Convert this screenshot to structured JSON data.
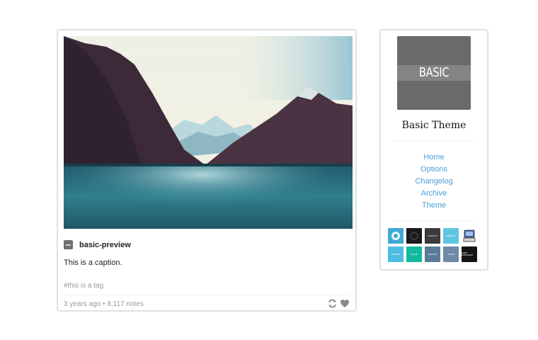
{
  "post": {
    "photo_alt": "",
    "author": "basic-preview",
    "caption": "This is a caption.",
    "tag": "#this is a tag",
    "date": "3 years ago",
    "notes": "8,117 notes",
    "separator": "•"
  },
  "sidebar": {
    "logo_text": "BASIC",
    "blog_title": "Basic Theme",
    "nav": [
      {
        "label": "Home"
      },
      {
        "label": "Options"
      },
      {
        "label": "Changelog"
      },
      {
        "label": "Archive"
      },
      {
        "label": "Theme"
      }
    ],
    "themes": [
      {
        "color": "#3fa9d4",
        "label": ""
      },
      {
        "color": "#1a1a1a",
        "label": ""
      },
      {
        "color": "#3b3b3b",
        "label": "COPYCAT"
      },
      {
        "color": "#5fc6e0",
        "label": "SIMPLEX"
      },
      {
        "color": "#ffffff",
        "label": ""
      },
      {
        "color": "#4cbde0",
        "label": "VIBRANT"
      },
      {
        "color": "#12b99d",
        "label": "SOLAR"
      },
      {
        "color": "#5a7a98",
        "label": "SMOOTH"
      },
      {
        "color": "#6f8aa6",
        "label": "PAPER"
      },
      {
        "color": "#151515",
        "label": "DARK ELEGANCE"
      }
    ]
  },
  "colors": {
    "link": "#4a9ed6",
    "border": "#e1e1e1",
    "muted": "#999999"
  },
  "icons": [
    "reblog-icon",
    "heart-icon"
  ]
}
